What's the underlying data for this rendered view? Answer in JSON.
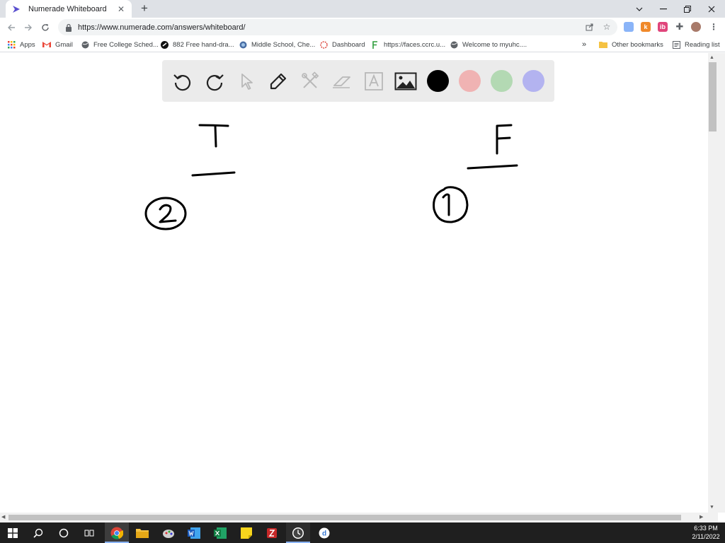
{
  "browser": {
    "tab_title": "Numerade Whiteboard",
    "url": "https://www.numerade.com/answers/whiteboard/"
  },
  "bookmarks": [
    {
      "label": "Apps"
    },
    {
      "label": "Gmail"
    },
    {
      "label": "Free College Sched..."
    },
    {
      "label": "882 Free hand-dra..."
    },
    {
      "label": "Middle School, Che..."
    },
    {
      "label": "Dashboard"
    },
    {
      "label": "https://faces.ccrc.u..."
    },
    {
      "label": "Welcome to myuhc...."
    },
    {
      "label": "Other bookmarks"
    },
    {
      "label": "Reading list"
    }
  ],
  "whiteboard": {
    "tools": [
      "undo-icon",
      "redo-icon",
      "pointer-icon",
      "pen-icon",
      "tools-icon",
      "eraser-icon",
      "text-icon",
      "image-icon"
    ],
    "colors": [
      "#000000",
      "#f0b3b3",
      "#b3d9b3",
      "#b3b3f0"
    ]
  },
  "taskbar": {
    "time": "6:33 PM",
    "date": "2/11/2022"
  }
}
